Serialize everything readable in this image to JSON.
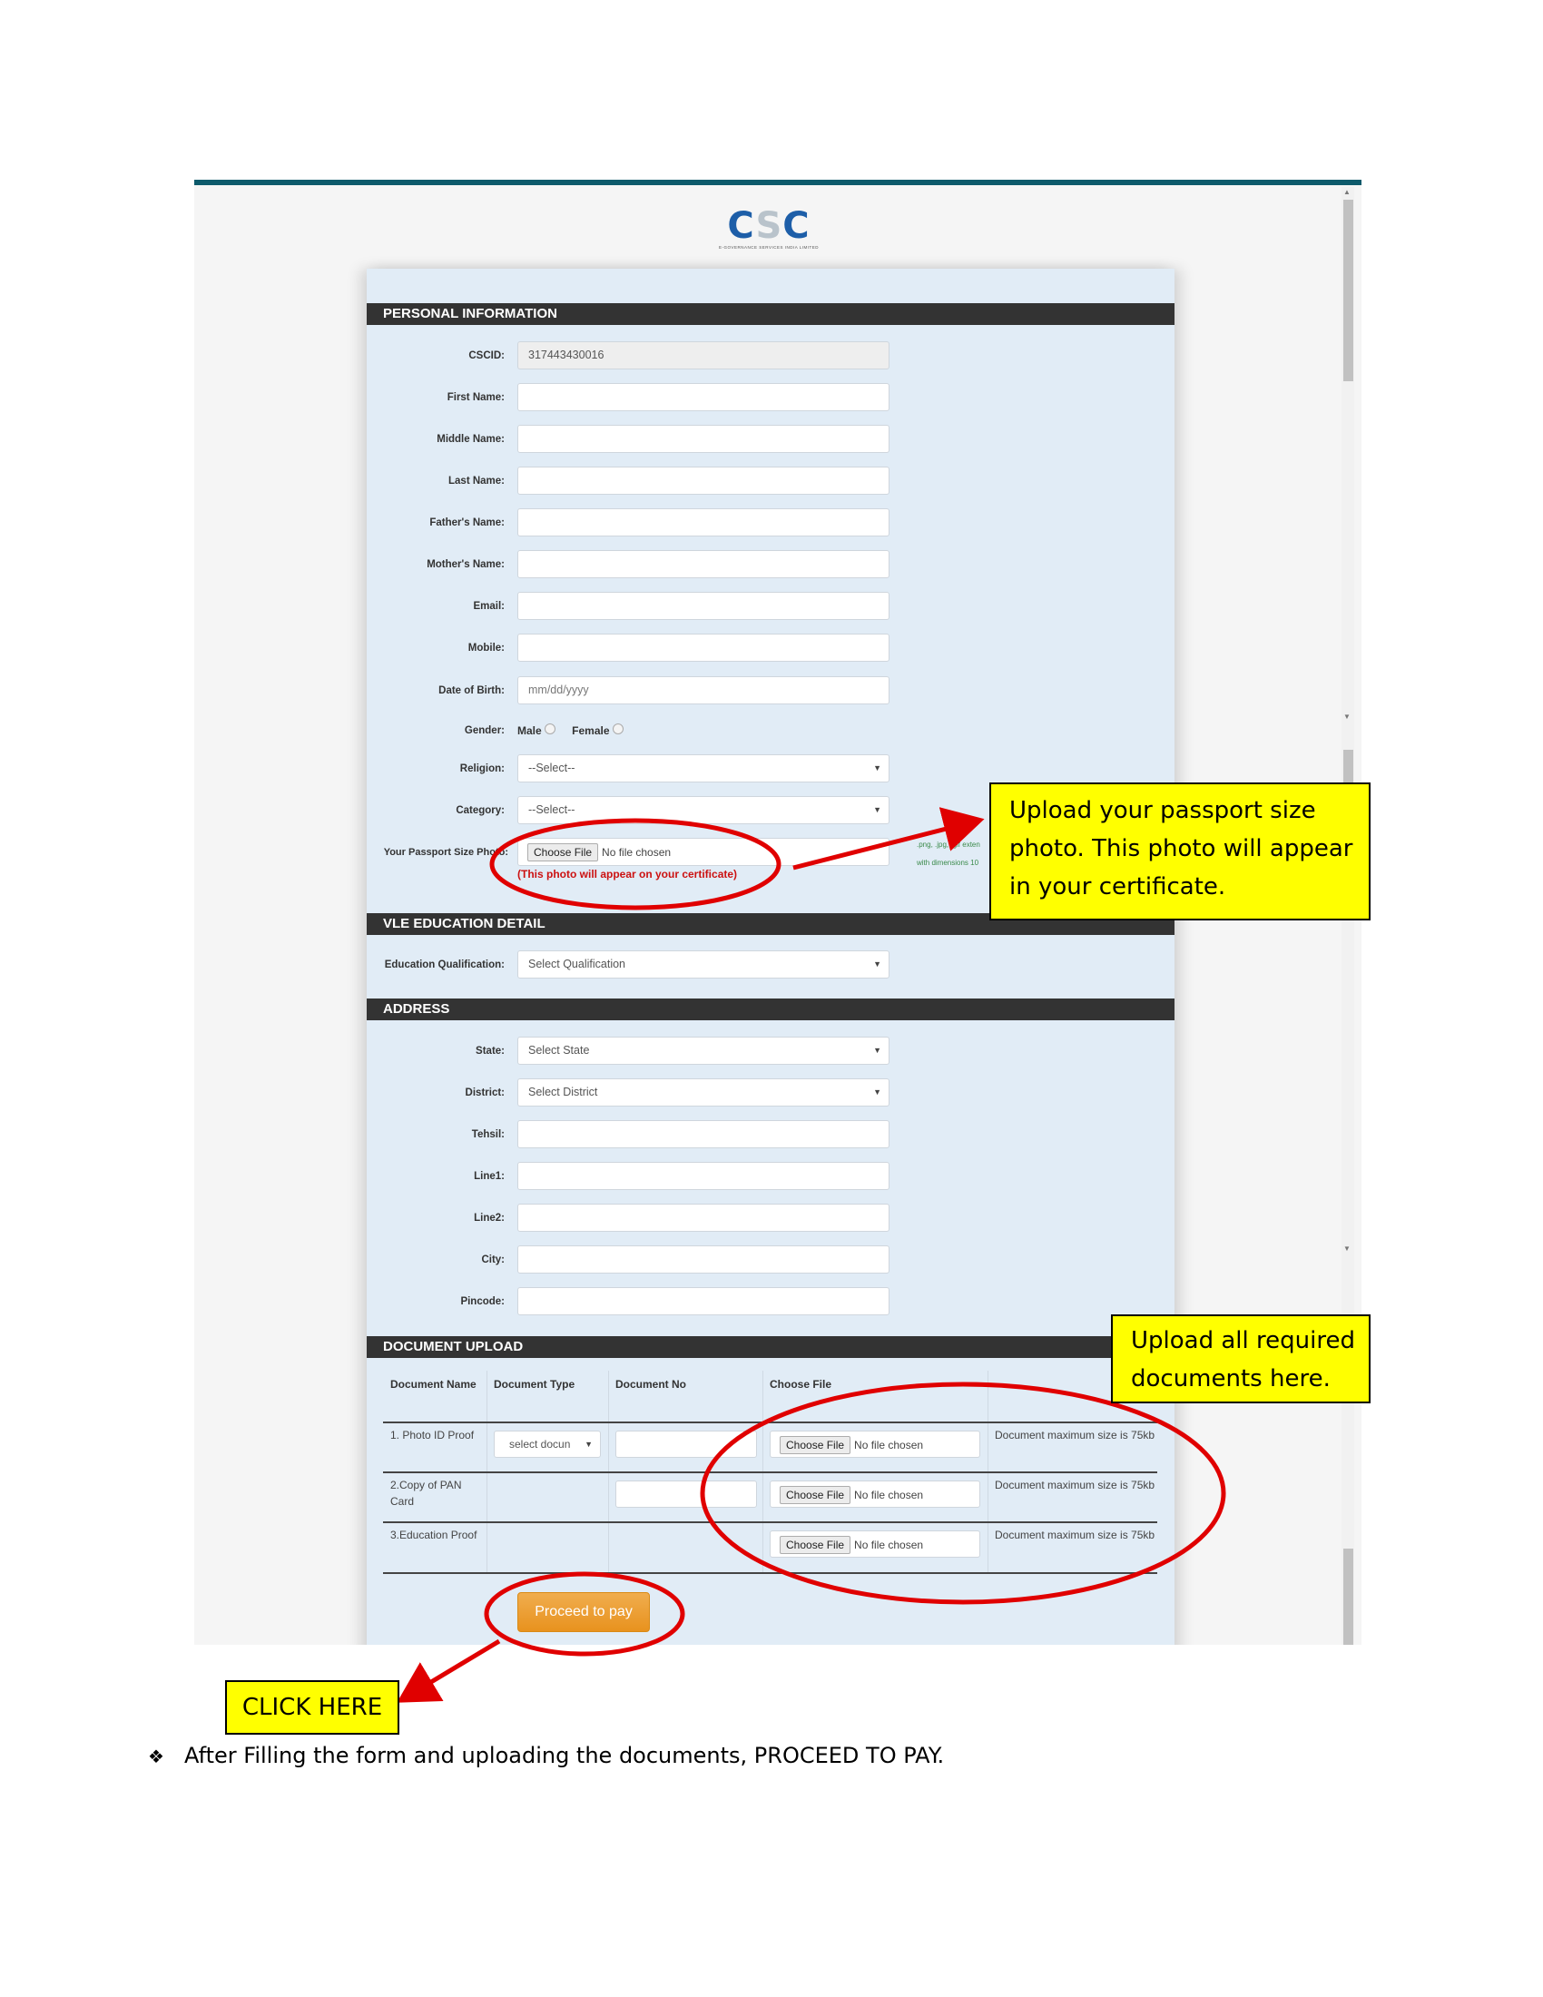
{
  "brand": {
    "logo_text": "CSC",
    "logo_tagline": "E-GOVERNANCE SERVICES INDIA LIMITED"
  },
  "sections": {
    "personal": "PERSONAL INFORMATION",
    "education": "VLE EDUCATION DETAIL",
    "address": "ADDRESS",
    "documents": "DOCUMENT UPLOAD"
  },
  "personal": {
    "cscid": {
      "label": "CSCID:",
      "value": "317443430016"
    },
    "first_name": {
      "label": "First Name:",
      "value": ""
    },
    "middle_name": {
      "label": "Middle Name:",
      "value": ""
    },
    "last_name": {
      "label": "Last Name:",
      "value": ""
    },
    "father_name": {
      "label": "Father's Name:",
      "value": ""
    },
    "mother_name": {
      "label": "Mother's Name:",
      "value": ""
    },
    "email": {
      "label": "Email:",
      "value": ""
    },
    "mobile": {
      "label": "Mobile:",
      "value": ""
    },
    "dob": {
      "label": "Date of Birth:",
      "placeholder": "mm/dd/yyyy"
    },
    "gender": {
      "label": "Gender:",
      "options": [
        "Male",
        "Female"
      ]
    },
    "religion": {
      "label": "Religion:",
      "selected": "--Select--"
    },
    "category": {
      "label": "Category:",
      "selected": "--Select--"
    },
    "photo": {
      "label": "Your Passport Size Photo:",
      "button": "Choose File",
      "status": "No file chosen",
      "note": "(This photo will appear on your certificate)",
      "hint_line1": ".png, .jpg, .gif exten",
      "hint_line2": "with dimensions 10"
    }
  },
  "education": {
    "qualification": {
      "label": "Education Qualification:",
      "selected": "Select Qualification"
    }
  },
  "address": {
    "state": {
      "label": "State:",
      "selected": "Select State"
    },
    "district": {
      "label": "District:",
      "selected": "Select District"
    },
    "tehsil": {
      "label": "Tehsil:",
      "value": ""
    },
    "line1": {
      "label": "Line1:",
      "value": ""
    },
    "line2": {
      "label": "Line2:",
      "value": ""
    },
    "city": {
      "label": "City:",
      "value": ""
    },
    "pincode": {
      "label": "Pincode:",
      "value": ""
    }
  },
  "documents": {
    "headers": [
      "Document Name",
      "Document Type",
      "Document No",
      "Choose File",
      ""
    ],
    "rows": [
      {
        "name": "1. Photo ID Proof",
        "type_select": "select docun",
        "file_button": "Choose File",
        "file_status": "No file chosen",
        "note": "Document maximum size is 75kb"
      },
      {
        "name": "2.Copy of PAN Card",
        "file_button": "Choose File",
        "file_status": "No file chosen",
        "note": "Document maximum size is 75kb"
      },
      {
        "name": "3.Education Proof",
        "file_button": "Choose File",
        "file_status": "No file chosen",
        "note": "Document maximum size is 75kb"
      }
    ]
  },
  "actions": {
    "proceed": "Proceed to pay"
  },
  "annotations": {
    "photo_callout": "Upload your passport size photo. This photo will appear in your certificate.",
    "docs_callout": "Upload all required documents here.",
    "click_callout": "CLICK HERE",
    "instruction_bullet": "❖",
    "instruction": "After Filling the form and uploading the documents, PROCEED TO PAY.",
    "highlight_color": "#ffff00",
    "marker_color": "#e00000"
  },
  "colors": {
    "topbar": "#0d5a6b",
    "section_header": "#333333",
    "form_bg": "#e1ecf6",
    "proceed_button": "#f0ad4e"
  }
}
